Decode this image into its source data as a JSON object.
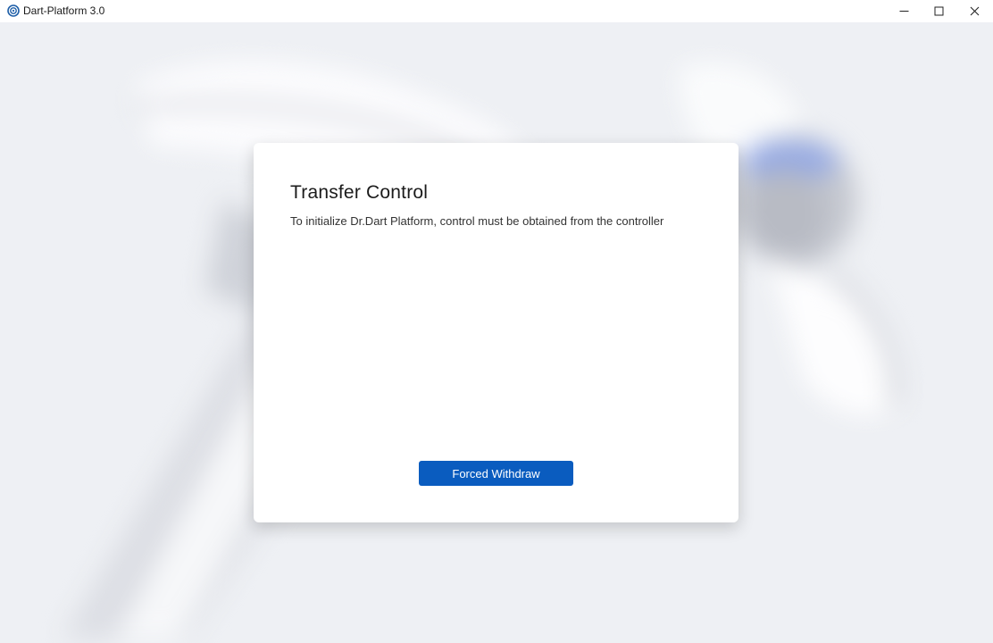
{
  "window": {
    "title": "Dart-Platform 3.0",
    "icon": "dart-logo-icon",
    "controls": [
      "minimize-icon",
      "maximize-icon",
      "close-icon"
    ]
  },
  "dialog": {
    "title": "Transfer Control",
    "description": "To initialize Dr.Dart Platform, control must be obtained from the controller",
    "primary_button": "Forced Withdraw"
  },
  "colors": {
    "background": "#eef0f4",
    "dialog_bg": "#ffffff",
    "primary": "#0a5cbf",
    "accent_glow": "#6f8de0"
  }
}
